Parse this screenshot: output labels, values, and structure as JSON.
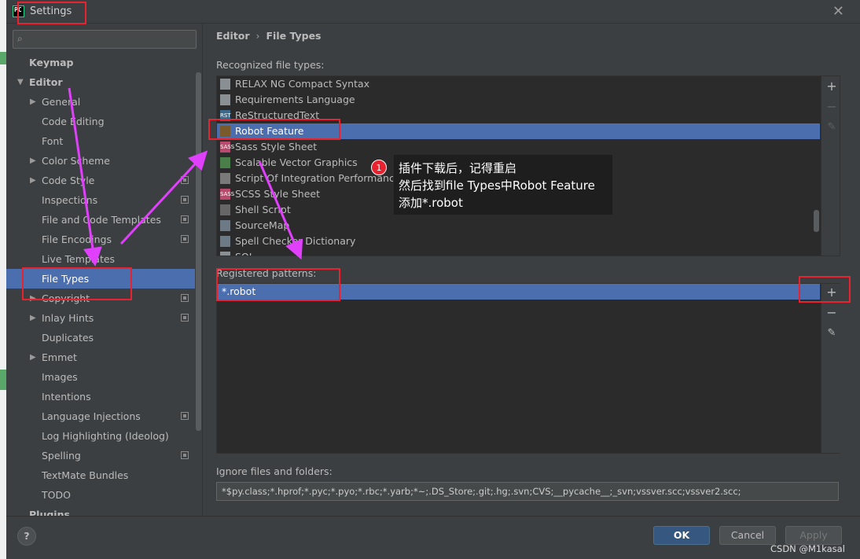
{
  "window": {
    "title": "Settings",
    "app_icon_text": "PC"
  },
  "search": {
    "placeholder": ""
  },
  "sidebar": {
    "items": [
      {
        "label": "Keymap",
        "bold": true
      },
      {
        "label": "Editor",
        "bold": true,
        "expanded": true
      },
      {
        "label": "General",
        "collapsible": true
      },
      {
        "label": "Code Editing"
      },
      {
        "label": "Font"
      },
      {
        "label": "Color Scheme",
        "collapsible": true
      },
      {
        "label": "Code Style",
        "collapsible": true,
        "project_icon": true
      },
      {
        "label": "Inspections",
        "project_icon": true
      },
      {
        "label": "File and Code Templates",
        "project_icon": true
      },
      {
        "label": "File Encodings",
        "project_icon": true
      },
      {
        "label": "Live Templates"
      },
      {
        "label": "File Types",
        "selected": true
      },
      {
        "label": "Copyright",
        "collapsible": true,
        "project_icon": true
      },
      {
        "label": "Inlay Hints",
        "collapsible": true,
        "project_icon": true
      },
      {
        "label": "Duplicates"
      },
      {
        "label": "Emmet",
        "collapsible": true
      },
      {
        "label": "Images"
      },
      {
        "label": "Intentions"
      },
      {
        "label": "Language Injections",
        "project_icon": true
      },
      {
        "label": "Log Highlighting (Ideolog)"
      },
      {
        "label": "Spelling",
        "project_icon": true
      },
      {
        "label": "TextMate Bundles"
      },
      {
        "label": "TODO"
      },
      {
        "label": "Plugins",
        "bold": true
      }
    ]
  },
  "breadcrumb": {
    "parent": "Editor",
    "current": "File Types"
  },
  "recognized": {
    "label": "Recognized file types:",
    "items": [
      {
        "label": "RELAX NG Compact Syntax",
        "icon": "doc-icon",
        "icon_text": ""
      },
      {
        "label": "Requirements Language",
        "icon": "doc-icon",
        "icon_text": ""
      },
      {
        "label": "ReStructuredText",
        "icon": "rst-icon",
        "icon_text": "RST"
      },
      {
        "label": "Robot Feature",
        "icon": "robot-icon",
        "icon_text": "",
        "selected": true
      },
      {
        "label": "Sass Style Sheet",
        "icon": "sass-icon",
        "icon_text": "SASS"
      },
      {
        "label": "Scalable Vector Graphics",
        "icon": "svg-icon",
        "icon_text": ""
      },
      {
        "label": "Script Of Integration Performance Test",
        "icon": "script-icon",
        "icon_text": ""
      },
      {
        "label": "SCSS Style Sheet",
        "icon": "scss-icon",
        "icon_text": "SASS"
      },
      {
        "label": "Shell Script",
        "icon": "shell-icon",
        "icon_text": ""
      },
      {
        "label": "SourceMap",
        "icon": "map-icon",
        "icon_text": ""
      },
      {
        "label": "Spell Checker Dictionary",
        "icon": "dict-icon",
        "icon_text": ""
      },
      {
        "label": "SQL",
        "icon": "doc-icon",
        "icon_text": ""
      }
    ]
  },
  "patterns": {
    "label": "Registered patterns:",
    "items": [
      "*.robot"
    ]
  },
  "ignore": {
    "label": "Ignore files and folders:",
    "value": "*$py.class;*.hprof;*.pyc;*.pyo;*.rbc;*.yarb;*~;.DS_Store;.git;.hg;.svn;CVS;__pycache__;_svn;vssver.scc;vssver2.scc;"
  },
  "toolbar": {
    "add": "+",
    "remove": "−",
    "edit": "✎"
  },
  "buttons": {
    "help": "?",
    "ok": "OK",
    "cancel": "Cancel",
    "apply": "Apply"
  },
  "annotation": {
    "badge": "1",
    "lines": [
      "插件下载后，记得重启",
      "然后找到file Types中Robot Feature",
      "添加*.robot"
    ]
  },
  "watermark": "CSDN @M1kasal",
  "colors": {
    "selection": "#4b6eaf",
    "annotation_red": "#e8232f",
    "arrow_magenta": "#e040fb",
    "ok_button": "#365880"
  }
}
